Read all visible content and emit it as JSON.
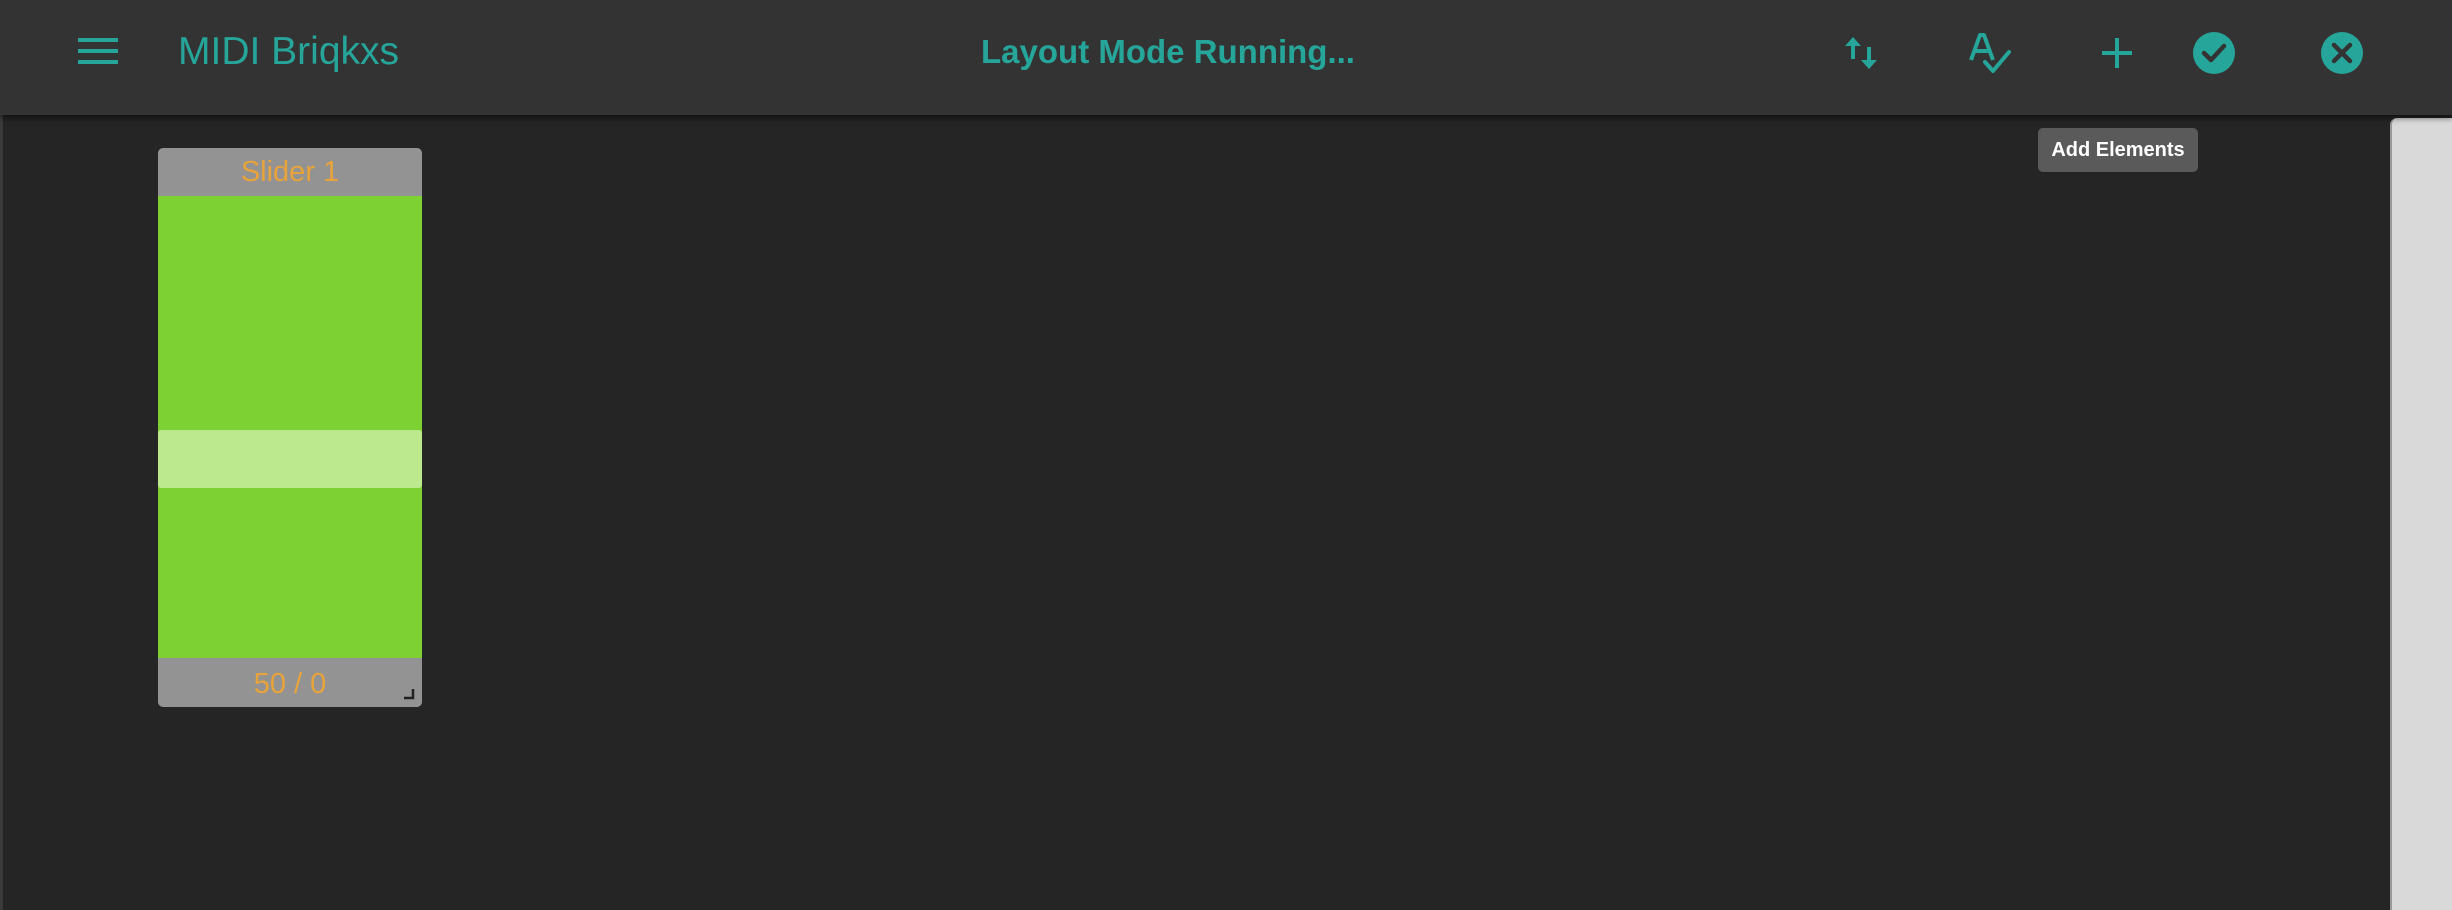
{
  "app": {
    "title": "MIDI Briqkxs",
    "mode_status": "Layout Mode Running..."
  },
  "toolbar": {
    "accent_color": "#26a69a",
    "icons": {
      "menu": "menu-icon",
      "swap": "swap-vertical-icon",
      "spellcheck": "spellcheck-icon",
      "add": "plus-icon",
      "confirm": "check-circle-icon",
      "cancel": "close-circle-icon"
    },
    "tooltip": "Add Elements"
  },
  "slider": {
    "label": "Slider 1",
    "value_text": "50 / 0",
    "value": 50,
    "thumb_level": 0.42,
    "track_color": "#7ed132",
    "thumb_color": "#bce88e",
    "text_color": "#e8a33a"
  }
}
